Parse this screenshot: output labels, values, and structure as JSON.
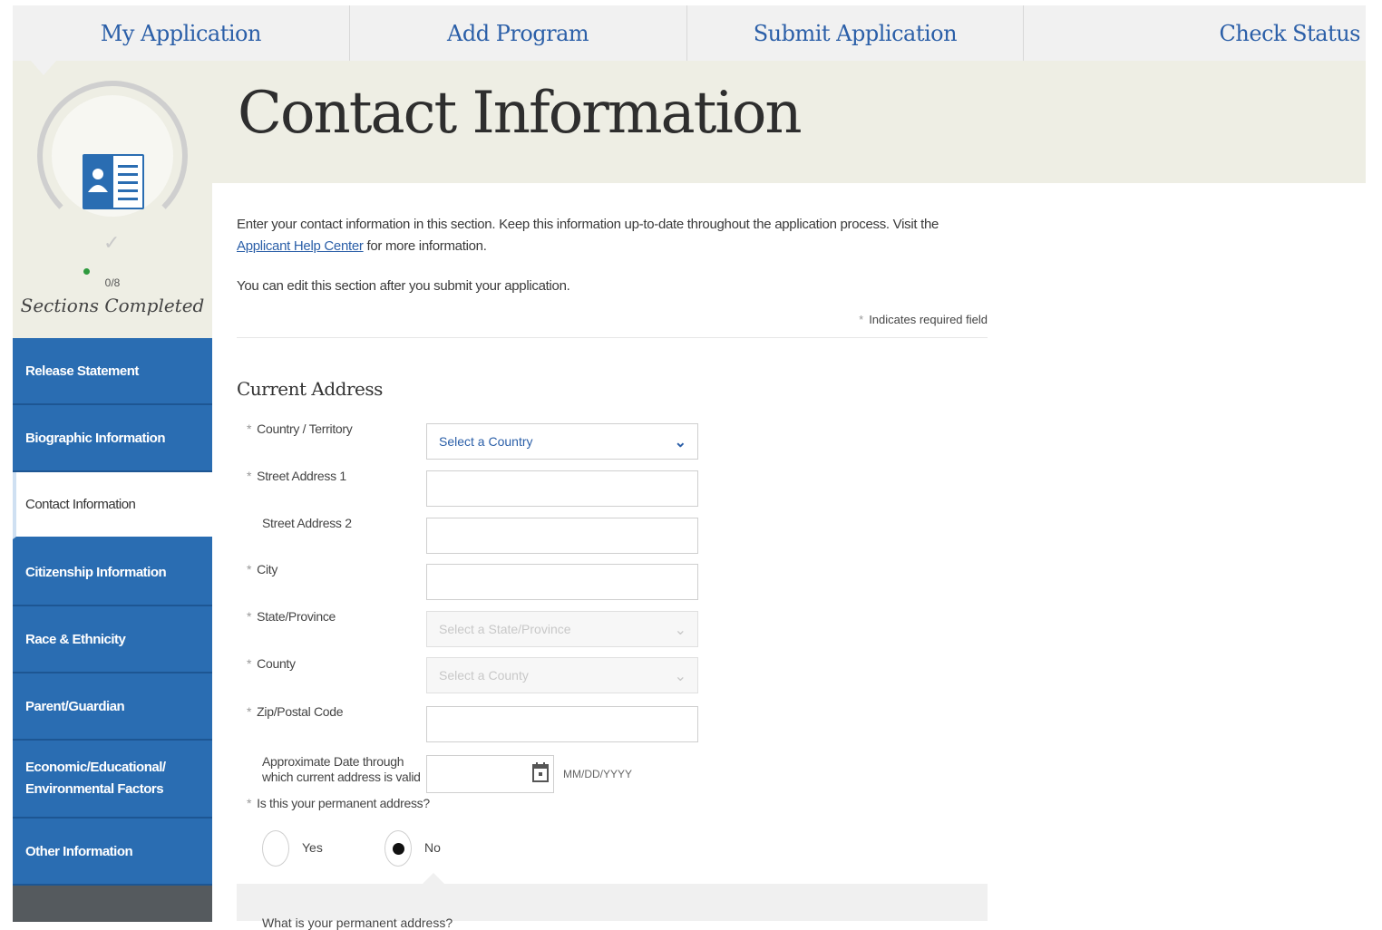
{
  "topnav": {
    "tabs": [
      "My Application",
      "Add Program",
      "Submit Application",
      "Check Status"
    ]
  },
  "progress": {
    "count": "0/8",
    "label": "Sections Completed"
  },
  "sidebar": {
    "items": [
      {
        "label": "Release Statement"
      },
      {
        "label": "Biographic Information"
      },
      {
        "label": "Contact Information"
      },
      {
        "label": "Citizenship Information"
      },
      {
        "label": "Race & Ethnicity"
      },
      {
        "label": "Parent/Guardian"
      },
      {
        "label": "Economic/Educational/"
      },
      {
        "label": "Other Information"
      }
    ],
    "item7_line2": "Environmental Factors",
    "active_index": 2
  },
  "page": {
    "title": "Contact Information",
    "intro_before": "Enter your contact information in this section. Keep this information up-to-date throughout the application process. Visit the ",
    "intro_link": "Applicant Help Center",
    "intro_after": " for more information.",
    "edit_note": "You can edit this section after you submit your application.",
    "required_note": "Indicates required field"
  },
  "form": {
    "section_title": "Current Address",
    "country_label": "Country / Territory",
    "country_value": "Select a Country",
    "street1_label": "Street Address 1",
    "street2_label": "Street Address 2",
    "city_label": "City",
    "state_label": "State/Province",
    "state_value": "Select a State/Province",
    "county_label": "County",
    "county_value": "Select a County",
    "zip_label": "Zip/Postal Code",
    "date_label_line1": "Approximate Date through",
    "date_label_line2": "which current address is valid",
    "date_hint": "MM/DD/YYYY",
    "permanent_label": "Is this your permanent address?",
    "yes_label": "Yes",
    "no_label": "No",
    "selected": "No",
    "sub_question": "What is your permanent address?"
  }
}
